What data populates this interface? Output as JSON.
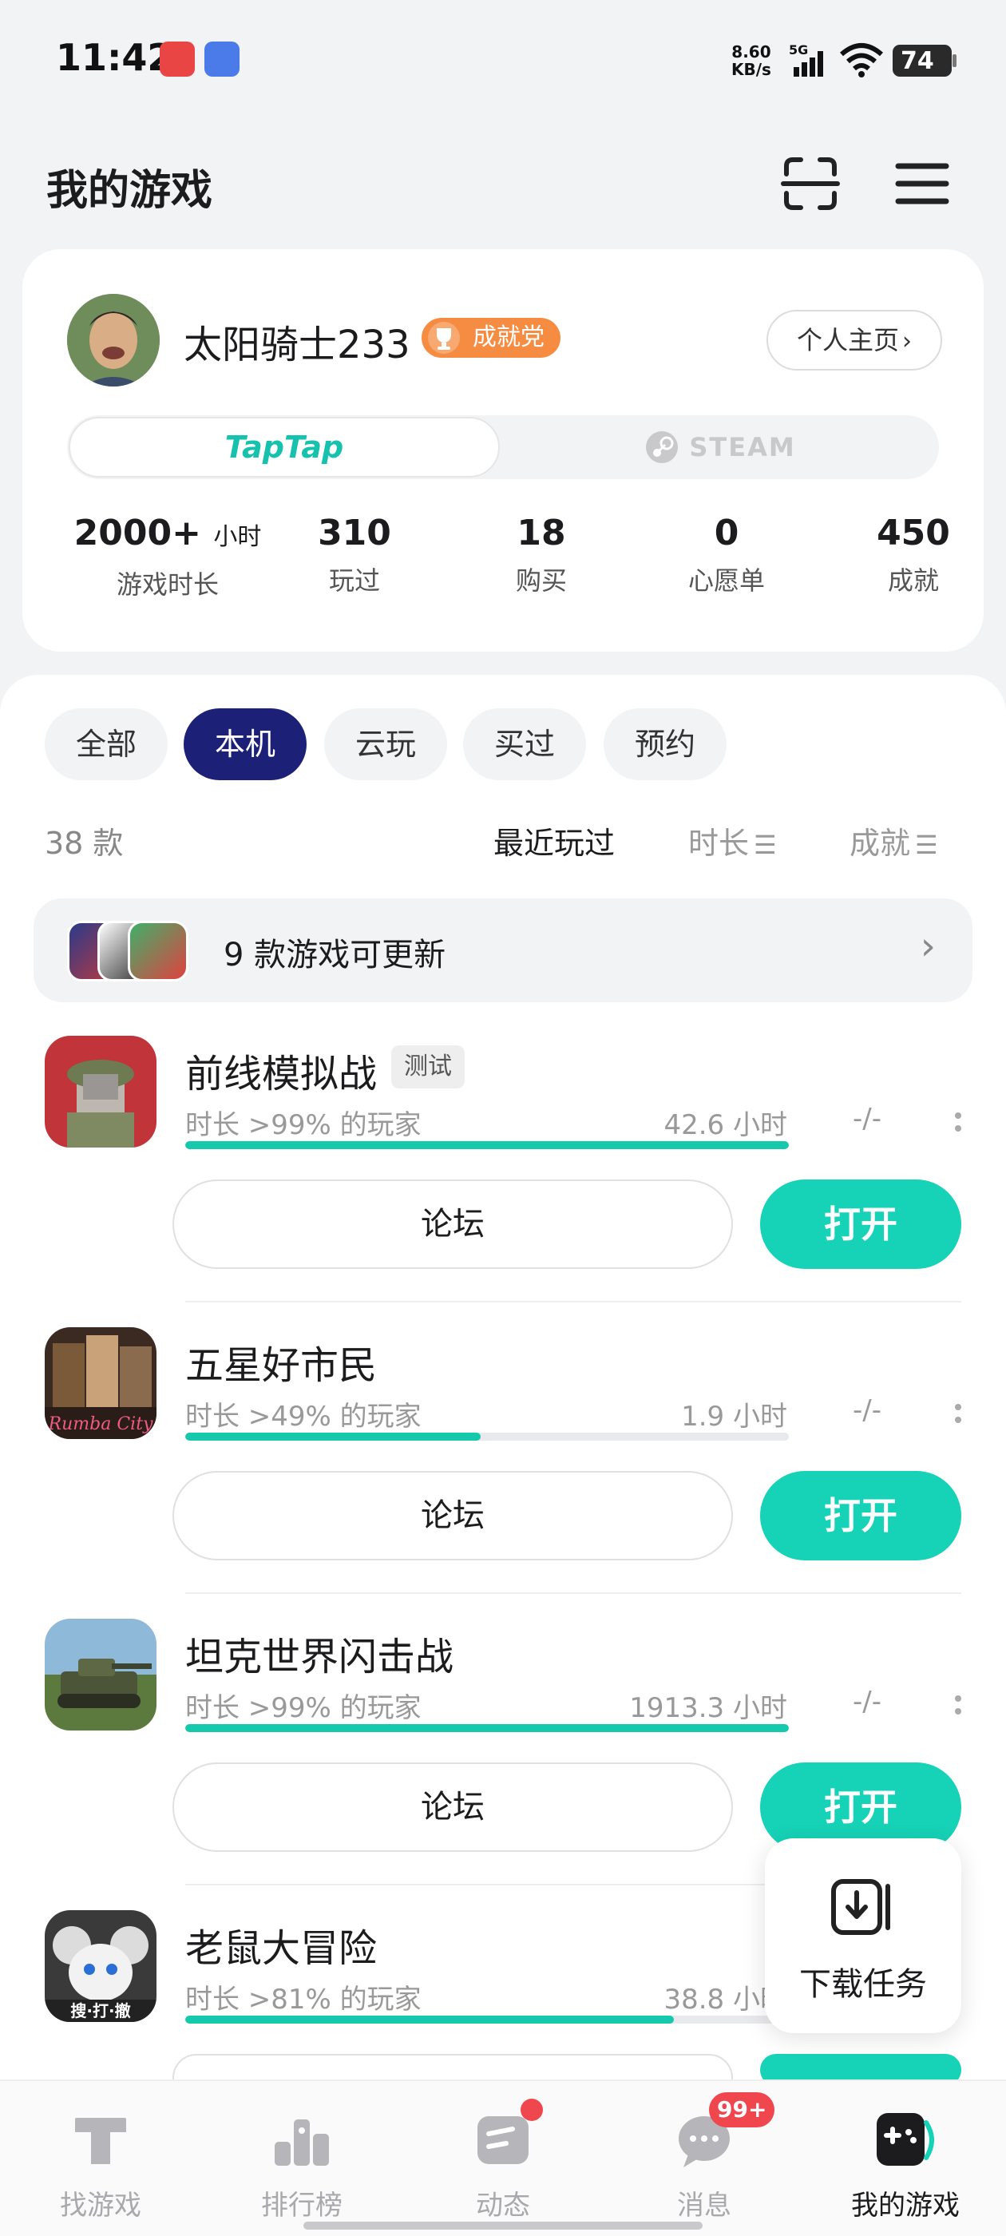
{
  "status_bar": {
    "time": "11:42",
    "net_speed_value": "8.60",
    "net_speed_unit": "KB/s",
    "network": "5G",
    "battery": "74"
  },
  "header": {
    "title": "我的游戏"
  },
  "profile": {
    "username": "太阳骑士233",
    "badge": "成就党",
    "profile_button": "个人主页",
    "platform_tabs": [
      "TapTap",
      "STEAM"
    ],
    "stats": [
      {
        "value": "2000+",
        "unit": "小时",
        "label": "游戏时长"
      },
      {
        "value": "310",
        "unit": "",
        "label": "玩过"
      },
      {
        "value": "18",
        "unit": "",
        "label": "购买"
      },
      {
        "value": "0",
        "unit": "",
        "label": "心愿单"
      },
      {
        "value": "450",
        "unit": "",
        "label": "成就"
      }
    ]
  },
  "filters": [
    "全部",
    "本机",
    "云玩",
    "买过",
    "预约"
  ],
  "active_filter": "本机",
  "game_count": "38 款",
  "sort_options": [
    "最近玩过",
    "时长",
    "成就"
  ],
  "update_banner": {
    "text": "9 款游戏可更新"
  },
  "games": [
    {
      "name": "前线模拟战",
      "tag": "测试",
      "rank": "时长 >99% 的玩家",
      "hours": "42.6 小时",
      "progress": 1.0,
      "achievements": "-/-",
      "forum": "论坛",
      "action": "打开"
    },
    {
      "name": "五星好市民",
      "tag": "",
      "rank": "时长 >49% 的玩家",
      "hours": "1.9 小时",
      "progress": 0.49,
      "achievements": "-/-",
      "forum": "论坛",
      "action": "打开"
    },
    {
      "name": "坦克世界闪击战",
      "tag": "",
      "rank": "时长 >99% 的玩家",
      "hours": "1913.3 小时",
      "progress": 1.0,
      "achievements": "-/-",
      "forum": "论坛",
      "action": "打开"
    },
    {
      "name": "老鼠大冒险",
      "tag": "",
      "rank": "时长 >81% 的玩家",
      "hours": "38.8 小时",
      "progress": 0.81,
      "achievements": "",
      "forum": "",
      "action": ""
    }
  ],
  "download_float": {
    "label": "下载任务"
  },
  "bottom_nav": [
    {
      "label": "找游戏",
      "icon": "find-game-icon"
    },
    {
      "label": "排行榜",
      "icon": "ranking-icon"
    },
    {
      "label": "动态",
      "icon": "feed-icon",
      "dot": true
    },
    {
      "label": "消息",
      "icon": "message-icon",
      "badge": "99+"
    },
    {
      "label": "我的游戏",
      "icon": "my-games-icon",
      "active": true
    }
  ],
  "colors": {
    "accent": "#16d2b6",
    "active_chip": "#1c2177",
    "badge_orange": "#f58c42",
    "alert_red": "#f0474f"
  }
}
